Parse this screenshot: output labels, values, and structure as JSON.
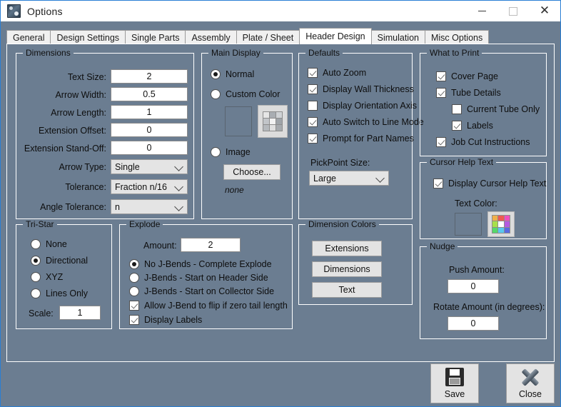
{
  "window": {
    "title": "Options",
    "minimize_label": "–",
    "maximize_label": "□",
    "close_label": "×"
  },
  "tabs": [
    {
      "label": "General",
      "active": false
    },
    {
      "label": "Design Settings",
      "active": false
    },
    {
      "label": "Single Parts",
      "active": false
    },
    {
      "label": "Assembly",
      "active": false
    },
    {
      "label": "Plate / Sheet",
      "active": false
    },
    {
      "label": "Header Design",
      "active": true
    },
    {
      "label": "Simulation",
      "active": false
    },
    {
      "label": "Misc Options",
      "active": false
    }
  ],
  "dimensions": {
    "title": "Dimensions",
    "fields": [
      {
        "label": "Text Size:",
        "value": "2"
      },
      {
        "label": "Arrow Width:",
        "value": "0.5"
      },
      {
        "label": "Arrow Length:",
        "value": "1"
      },
      {
        "label": "Extension Offset:",
        "value": "0"
      },
      {
        "label": "Extension Stand-Off:",
        "value": "0"
      }
    ],
    "combos": [
      {
        "label": "Arrow Type:",
        "value": "Single"
      },
      {
        "label": "Tolerance:",
        "value": "Fraction n/16"
      },
      {
        "label": "Angle Tolerance:",
        "value": "n"
      }
    ]
  },
  "main_display": {
    "title": "Main Display",
    "options": [
      {
        "label": "Normal",
        "selected": true
      },
      {
        "label": "Custom Color",
        "selected": false
      },
      {
        "label": "Image",
        "selected": false
      }
    ],
    "swatch_color": "#6b7d91",
    "choose_label": "Choose...",
    "image_name": "none"
  },
  "defaults": {
    "title": "Defaults",
    "checkboxes": [
      {
        "label": "Auto Zoom",
        "checked": true
      },
      {
        "label": "Display Wall Thickness",
        "checked": true
      },
      {
        "label": "Display Orientation Axis",
        "checked": false
      },
      {
        "label": "Auto Switch to Line Mode",
        "checked": true
      },
      {
        "label": "Prompt for Part Names",
        "checked": true
      }
    ],
    "pickpoint_label": "PickPoint Size:",
    "pickpoint_value": "Large"
  },
  "what_to_print": {
    "title": "What to Print",
    "checkboxes": [
      {
        "label": "Cover Page",
        "checked": true,
        "indent": 0
      },
      {
        "label": "Tube Details",
        "checked": true,
        "indent": 0
      },
      {
        "label": "Current Tube Only",
        "checked": false,
        "indent": 1
      },
      {
        "label": "Labels",
        "checked": true,
        "indent": 1
      },
      {
        "label": "Job Cut Instructions",
        "checked": true,
        "indent": 0
      }
    ]
  },
  "cursor_help_text": {
    "title": "Cursor Help Text",
    "checkbox": {
      "label": "Display Cursor Help Text",
      "checked": true
    },
    "color_label": "Text Color:",
    "swatch_color": "#6b7d91",
    "palette_colors": [
      "#f0b04a",
      "#ee5a52",
      "#ee4fbe",
      "#a8e04a",
      "#ffffff",
      "#b45ae0",
      "#56d96a",
      "#5ac8f0",
      "#5a6ae0"
    ]
  },
  "nudge": {
    "title": "Nudge",
    "push_label": "Push Amount:",
    "push_value": "0",
    "rotate_label": "Rotate Amount (in degrees):",
    "rotate_value": "0"
  },
  "tri_star": {
    "title": "Tri-Star",
    "options": [
      {
        "label": "None",
        "selected": false
      },
      {
        "label": "Directional",
        "selected": true
      },
      {
        "label": "XYZ",
        "selected": false
      },
      {
        "label": "Lines Only",
        "selected": false
      }
    ],
    "scale_label": "Scale:",
    "scale_value": "1"
  },
  "explode": {
    "title": "Explode",
    "amount_label": "Amount:",
    "amount_value": "2",
    "options": [
      {
        "label": "No J-Bends  -  Complete Explode",
        "selected": true
      },
      {
        "label": "J-Bends  -  Start on Header Side",
        "selected": false
      },
      {
        "label": "J-Bends  -  Start on Collector Side",
        "selected": false
      }
    ],
    "checkboxes": [
      {
        "label": "Allow J-Bend to flip if zero tail length",
        "checked": true
      },
      {
        "label": "Display Labels",
        "checked": true
      }
    ]
  },
  "dimension_colors": {
    "title": "Dimension Colors",
    "buttons": [
      "Extensions",
      "Dimensions",
      "Text"
    ]
  },
  "footer": {
    "save_label": "Save",
    "close_label": "Close"
  },
  "theme": {
    "background": "#6b7d91",
    "accent": "#2a7fd4"
  }
}
